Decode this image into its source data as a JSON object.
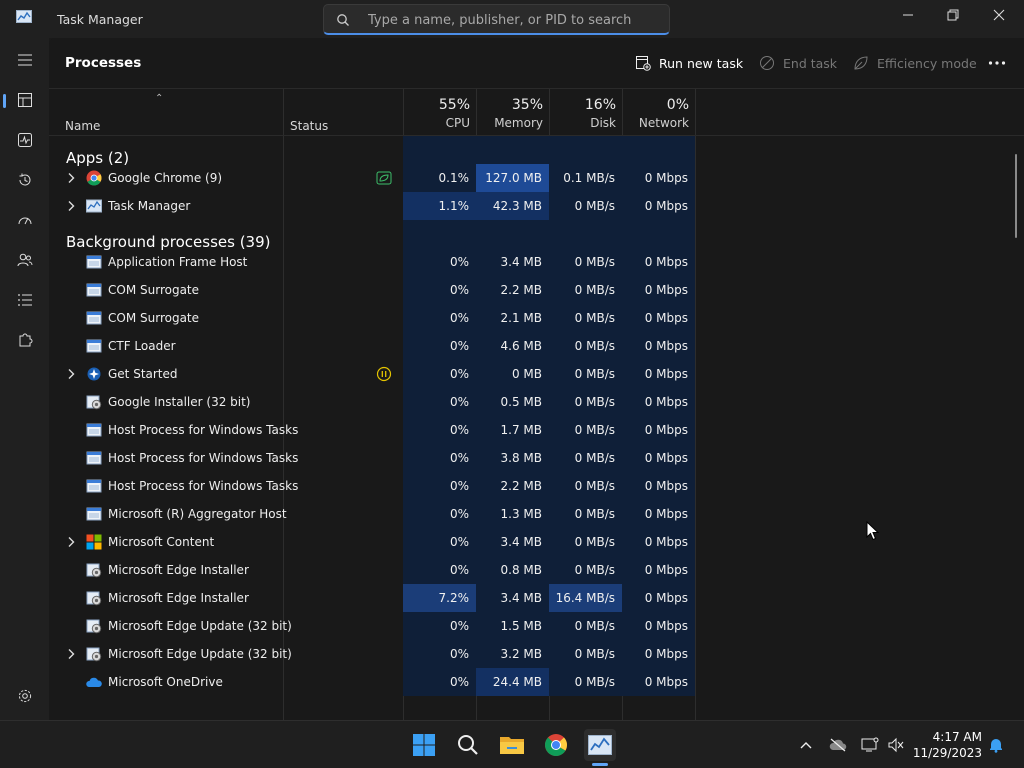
{
  "window": {
    "title": "Task Manager"
  },
  "search": {
    "placeholder": "Type a name, publisher, or PID to search"
  },
  "page": {
    "title": "Processes"
  },
  "toolbar": {
    "run_new_task": "Run new task",
    "end_task": "End task",
    "efficiency_mode": "Efficiency mode"
  },
  "columns": {
    "name": "Name",
    "status": "Status",
    "cpu": {
      "pct": "55%",
      "label": "CPU"
    },
    "memory": {
      "pct": "35%",
      "label": "Memory"
    },
    "disk": {
      "pct": "16%",
      "label": "Disk"
    },
    "network": {
      "pct": "0%",
      "label": "Network"
    }
  },
  "groups": {
    "apps": "Apps (2)",
    "background": "Background processes (39)"
  },
  "apps": [
    {
      "name": "Google Chrome (9)",
      "cpu": "0.1%",
      "memory": "127.0 MB",
      "disk": "0.1 MB/s",
      "network": "0 Mbps",
      "icon": "chrome-icon",
      "expandable": true,
      "status_icon": "efficiency-leaf-icon"
    },
    {
      "name": "Task Manager",
      "cpu": "1.1%",
      "memory": "42.3 MB",
      "disk": "0 MB/s",
      "network": "0 Mbps",
      "icon": "task-manager-icon",
      "expandable": true
    }
  ],
  "background": [
    {
      "name": "Application Frame Host",
      "cpu": "0%",
      "memory": "3.4 MB",
      "disk": "0 MB/s",
      "network": "0 Mbps",
      "icon": "window-app-icon"
    },
    {
      "name": "COM Surrogate",
      "cpu": "0%",
      "memory": "2.2 MB",
      "disk": "0 MB/s",
      "network": "0 Mbps",
      "icon": "window-app-icon"
    },
    {
      "name": "COM Surrogate",
      "cpu": "0%",
      "memory": "2.1 MB",
      "disk": "0 MB/s",
      "network": "0 Mbps",
      "icon": "window-app-icon"
    },
    {
      "name": "CTF Loader",
      "cpu": "0%",
      "memory": "4.6 MB",
      "disk": "0 MB/s",
      "network": "0 Mbps",
      "icon": "window-app-icon"
    },
    {
      "name": "Get Started",
      "cpu": "0%",
      "memory": "0 MB",
      "disk": "0 MB/s",
      "network": "0 Mbps",
      "icon": "get-started-icon",
      "expandable": true,
      "status_icon": "suspended-icon"
    },
    {
      "name": "Google Installer (32 bit)",
      "cpu": "0%",
      "memory": "0.5 MB",
      "disk": "0 MB/s",
      "network": "0 Mbps",
      "icon": "installer-icon"
    },
    {
      "name": "Host Process for Windows Tasks",
      "cpu": "0%",
      "memory": "1.7 MB",
      "disk": "0 MB/s",
      "network": "0 Mbps",
      "icon": "window-app-icon"
    },
    {
      "name": "Host Process for Windows Tasks",
      "cpu": "0%",
      "memory": "3.8 MB",
      "disk": "0 MB/s",
      "network": "0 Mbps",
      "icon": "window-app-icon"
    },
    {
      "name": "Host Process for Windows Tasks",
      "cpu": "0%",
      "memory": "2.2 MB",
      "disk": "0 MB/s",
      "network": "0 Mbps",
      "icon": "window-app-icon"
    },
    {
      "name": "Microsoft (R) Aggregator Host",
      "cpu": "0%",
      "memory": "1.3 MB",
      "disk": "0 MB/s",
      "network": "0 Mbps",
      "icon": "window-app-icon"
    },
    {
      "name": "Microsoft Content",
      "cpu": "0%",
      "memory": "3.4 MB",
      "disk": "0 MB/s",
      "network": "0 Mbps",
      "icon": "microsoft-logo-icon",
      "expandable": true
    },
    {
      "name": "Microsoft Edge Installer",
      "cpu": "0%",
      "memory": "0.8 MB",
      "disk": "0 MB/s",
      "network": "0 Mbps",
      "icon": "installer-icon"
    },
    {
      "name": "Microsoft Edge Installer",
      "cpu": "7.2%",
      "memory": "3.4 MB",
      "disk": "16.4 MB/s",
      "network": "0 Mbps",
      "icon": "installer-icon",
      "hot": true
    },
    {
      "name": "Microsoft Edge Update (32 bit)",
      "cpu": "0%",
      "memory": "1.5 MB",
      "disk": "0 MB/s",
      "network": "0 Mbps",
      "icon": "installer-icon"
    },
    {
      "name": "Microsoft Edge Update (32 bit)",
      "cpu": "0%",
      "memory": "3.2 MB",
      "disk": "0 MB/s",
      "network": "0 Mbps",
      "icon": "installer-icon",
      "expandable": true
    },
    {
      "name": "Microsoft OneDrive",
      "cpu": "0%",
      "memory": "24.4 MB",
      "disk": "0 MB/s",
      "network": "0 Mbps",
      "icon": "onedrive-icon"
    }
  ],
  "taskbar": {
    "clock_time": "4:17 AM",
    "clock_date": "11/29/2023"
  },
  "colors": {
    "accent": "#60a5f7",
    "heat_low": "#0f1f38",
    "heat_mid": "#133062",
    "heat_high": "#1e4a96"
  }
}
